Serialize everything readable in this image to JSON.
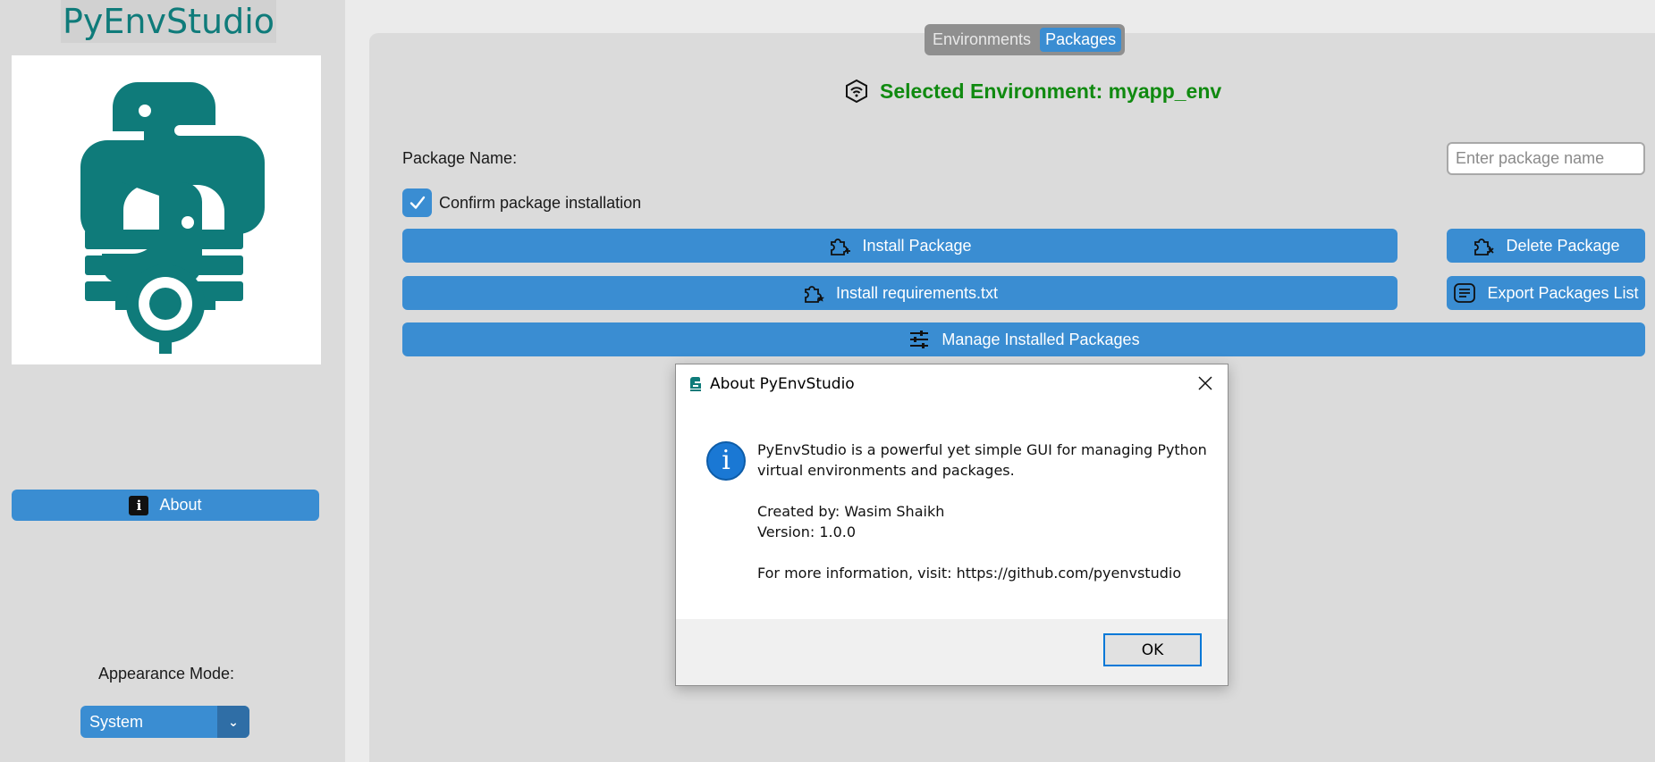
{
  "sidebar": {
    "app_title": "PyEnvStudio",
    "about_label": "About",
    "appearance_label": "Appearance Mode:",
    "appearance_value": "System"
  },
  "tabs": [
    {
      "label": "Environments",
      "active": false
    },
    {
      "label": "Packages",
      "active": true
    }
  ],
  "main": {
    "selected_env": "Selected Environment: myapp_env",
    "package_name_label": "Package Name:",
    "package_input_placeholder": "Enter package name",
    "confirm_label": "Confirm package installation",
    "confirm_checked": true,
    "buttons": {
      "install": "Install Package",
      "delete": "Delete Package",
      "install_requirements": "Install requirements.txt",
      "export": "Export Packages List",
      "manage": "Manage Installed Packages"
    }
  },
  "dialog": {
    "title": "About PyEnvStudio",
    "description": "PyEnvStudio is a powerful yet simple GUI for managing Python\nvirtual environments and packages.",
    "credits": "Created by: Wasim Shaikh\nVersion: 1.0.0",
    "more_info": "For more information, visit: https://github.com/pyenvstudio",
    "ok_label": "OK"
  },
  "colors": {
    "accent": "#3a8dd2",
    "brand_teal": "#0f7b7a",
    "env_green": "#108a10"
  }
}
